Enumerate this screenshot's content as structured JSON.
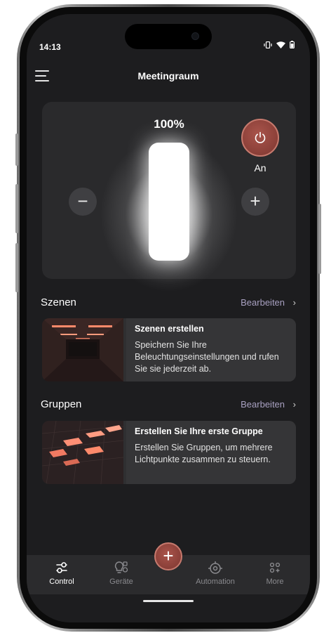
{
  "status_bar": {
    "time": "14:13",
    "icons": [
      "vibrate-icon",
      "wifi-icon",
      "battery-icon"
    ]
  },
  "header": {
    "title": "Meetingraum",
    "menu_icon": "hamburger-menu-icon"
  },
  "light_control": {
    "brightness_label": "100%",
    "brightness_value": 1.0,
    "minus_label": "−",
    "plus_label": "+",
    "power_icon": "power-icon",
    "power_state_label": "An"
  },
  "scenes": {
    "title": "Szenen",
    "edit_label": "Bearbeiten",
    "chevron": "›",
    "card": {
      "heading": "Szenen erstellen",
      "body": "Speichern Sie Ihre Beleuchtungseinstellungen und rufen Sie sie jederzeit ab."
    }
  },
  "groups": {
    "title": "Gruppen",
    "edit_label": "Bearbeiten",
    "chevron": "›",
    "card": {
      "heading": "Erstellen Sie Ihre erste Gruppe",
      "body": "Erstellen Sie Gruppen, um mehrere Lichtpunkte zusammen zu steuern."
    }
  },
  "tabbar": {
    "tabs": [
      {
        "label": "Control",
        "icon": "sliders-icon",
        "active": true
      },
      {
        "label": "Geräte",
        "icon": "bulb-devices-icon",
        "active": false
      },
      {
        "label": "Automation",
        "icon": "automation-icon",
        "active": false
      },
      {
        "label": "More",
        "icon": "more-grid-icon",
        "active": false
      }
    ],
    "fab_label": "+"
  },
  "colors": {
    "background": "#1d1d1f",
    "card": "#2a2a2c",
    "accent": "#8a3f38",
    "accent_border": "#c77a6e",
    "link": "#a8a0c0",
    "inactive_tab": "#8a8a8e"
  }
}
